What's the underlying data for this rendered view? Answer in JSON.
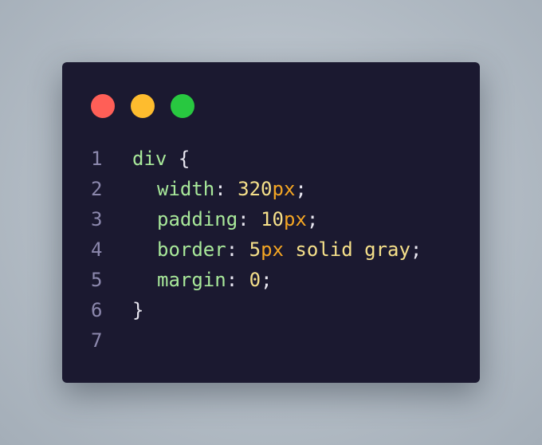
{
  "window": {
    "traffic_lights": [
      {
        "name": "close",
        "color": "#ff5f57"
      },
      {
        "name": "minimize",
        "color": "#febc2e"
      },
      {
        "name": "maximize",
        "color": "#28c840"
      }
    ]
  },
  "code": {
    "lines": [
      {
        "number": "1",
        "tokens": [
          {
            "t": "div",
            "k": "selector"
          },
          {
            "t": " ",
            "k": "punct"
          },
          {
            "t": "{",
            "k": "brace"
          }
        ]
      },
      {
        "number": "2",
        "tokens": [
          {
            "t": "width",
            "k": "prop"
          },
          {
            "t": ": ",
            "k": "punct"
          },
          {
            "t": "320",
            "k": "num"
          },
          {
            "t": "px",
            "k": "unit"
          },
          {
            "t": ";",
            "k": "punct"
          }
        ],
        "indent": true
      },
      {
        "number": "3",
        "tokens": [
          {
            "t": "padding",
            "k": "prop"
          },
          {
            "t": ": ",
            "k": "punct"
          },
          {
            "t": "10",
            "k": "num"
          },
          {
            "t": "px",
            "k": "unit"
          },
          {
            "t": ";",
            "k": "punct"
          }
        ],
        "indent": true
      },
      {
        "number": "4",
        "tokens": [
          {
            "t": "border",
            "k": "prop"
          },
          {
            "t": ": ",
            "k": "punct"
          },
          {
            "t": "5",
            "k": "num"
          },
          {
            "t": "px",
            "k": "unit"
          },
          {
            "t": " solid gray",
            "k": "value"
          },
          {
            "t": ";",
            "k": "punct"
          }
        ],
        "indent": true
      },
      {
        "number": "5",
        "tokens": [
          {
            "t": "margin",
            "k": "prop"
          },
          {
            "t": ": ",
            "k": "punct"
          },
          {
            "t": "0",
            "k": "num"
          },
          {
            "t": ";",
            "k": "punct"
          }
        ],
        "indent": true
      },
      {
        "number": "6",
        "tokens": [
          {
            "t": "}",
            "k": "brace"
          }
        ]
      },
      {
        "number": "7",
        "tokens": []
      }
    ]
  }
}
